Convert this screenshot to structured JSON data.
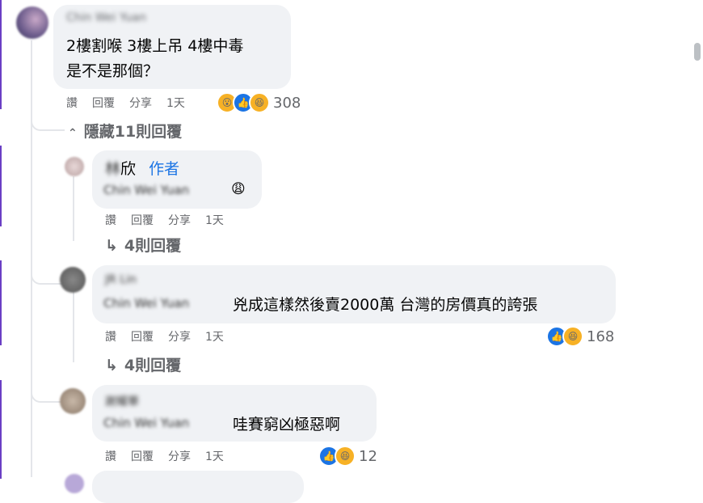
{
  "comments": [
    {
      "author_blurred": "Chin Wei Yuan",
      "text_line1": "2樓割喉 3樓上吊 4樓中毒",
      "text_line2": "是不是那個？",
      "actions": [
        "讚",
        "回覆",
        "分享",
        "1天"
      ],
      "reaction_icons": [
        "wow-icon",
        "like-icon",
        "haha-icon"
      ],
      "reaction_count": "308",
      "hide_replies": "隱藏11則回覆"
    }
  ],
  "replies": [
    {
      "author_blurred": "林欣",
      "author_suffix": "欣",
      "author_badge": "作者",
      "mention_blurred": "Chin Wei Yuan",
      "emoji": "😩",
      "actions": [
        "讚",
        "回覆",
        "分享",
        "1天"
      ],
      "more_replies": "4則回覆"
    },
    {
      "author_blurred": "JR Lin",
      "mention_blurred": "Chin Wei Yuan",
      "text": "兇成這樣然後賣2000萬 台灣的房價真的誇張",
      "actions": [
        "讚",
        "回覆",
        "分享",
        "1天"
      ],
      "reaction_icons": [
        "like-icon",
        "haha-icon"
      ],
      "reaction_count": "168",
      "more_replies": "4則回覆"
    },
    {
      "author_blurred": "謝耀華",
      "mention_blurred": "Chin Wei Yuan",
      "text": "哇賽窮凶極惡啊",
      "actions": [
        "讚",
        "回覆",
        "分享",
        "1天"
      ],
      "reaction_icons": [
        "like-icon",
        "haha-icon"
      ],
      "reaction_count": "12"
    }
  ],
  "icons": {
    "chevron": "⌃",
    "reply_arrow": "↳"
  },
  "colors": {
    "like_blue": "#1b74e4",
    "badge_blue": "#1b74e4",
    "bubble_bg": "#f0f2f5",
    "meta_gray": "#65676b"
  }
}
